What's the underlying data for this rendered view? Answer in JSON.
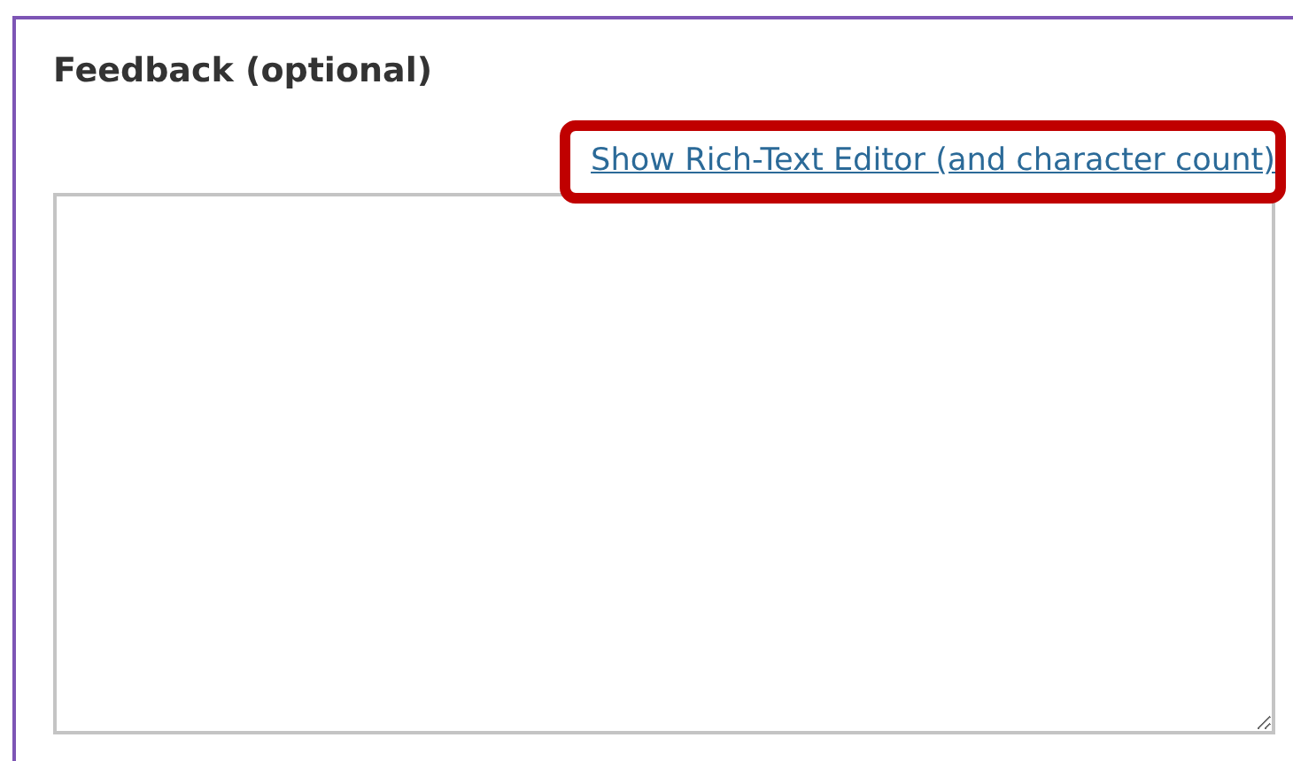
{
  "section": {
    "heading": "Feedback (optional)"
  },
  "editor_link": {
    "label": "Show Rich-Text Editor (and character count)",
    "highlighted": true
  }
}
